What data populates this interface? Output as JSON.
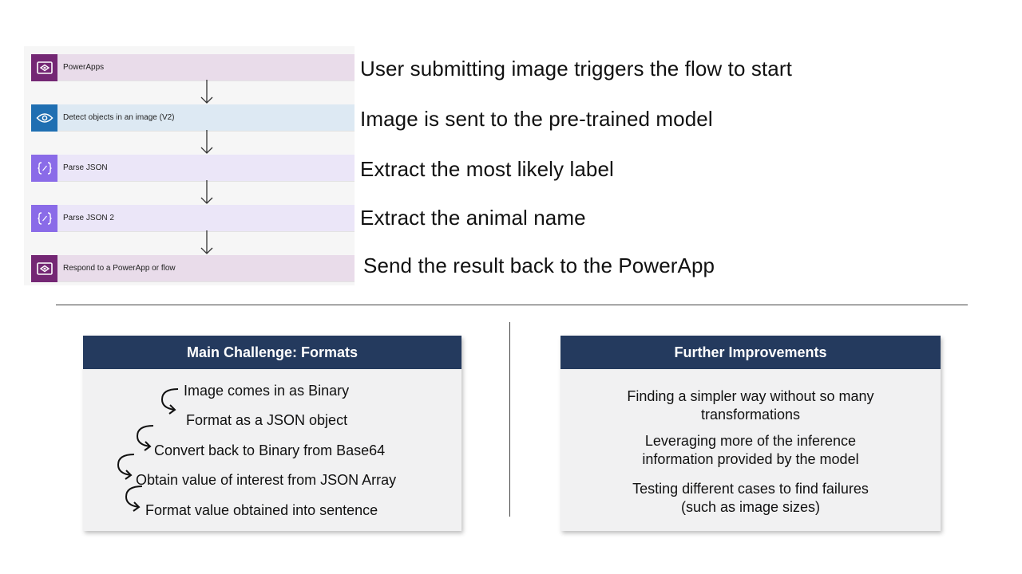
{
  "flow": {
    "steps": [
      {
        "label": "PowerApps",
        "icon": "powerapps-icon"
      },
      {
        "label": "Detect objects in an image (V2)",
        "icon": "eye-icon"
      },
      {
        "label": "Parse JSON",
        "icon": "json-icon"
      },
      {
        "label": "Parse JSON 2",
        "icon": "json-icon"
      },
      {
        "label": "Respond to a PowerApp or flow",
        "icon": "powerapps-icon"
      }
    ],
    "descriptions": [
      "User submitting image triggers the flow to start",
      "Image is sent to the pre-trained model",
      "Extract the most likely label",
      "Extract the animal name",
      "Send the result back to the PowerApp"
    ]
  },
  "challenge": {
    "title": "Main Challenge: Formats",
    "items": [
      "Image comes in as Binary",
      "Format as a JSON object",
      "Convert back to Binary from Base64",
      "Obtain value of interest from JSON Array",
      "Format value obtained into sentence"
    ]
  },
  "improvements": {
    "title": "Further Improvements",
    "items": [
      {
        "line1": "Finding a simpler way without so many",
        "line2": "transformations"
      },
      {
        "line1": "Leveraging more of the inference",
        "line2": "information provided by the model"
      },
      {
        "line1": "Testing different cases to find failures",
        "line2": "(such as image sizes)"
      }
    ]
  },
  "colors": {
    "header": "#243a5e",
    "powerapps": "#742774",
    "vision": "#1f6fb2",
    "json": "#8a6be8"
  }
}
